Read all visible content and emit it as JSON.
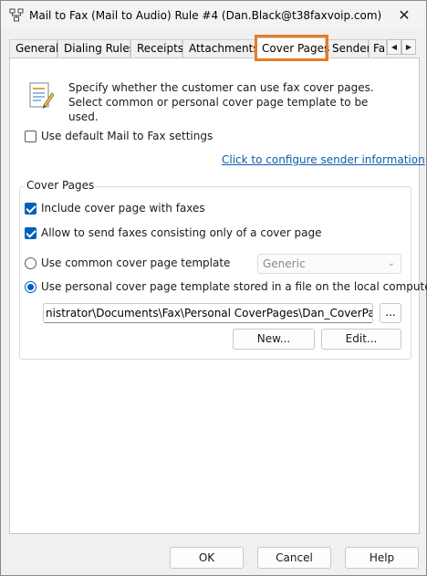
{
  "window": {
    "title": "Mail to Fax (Mail to Audio) Rule #4 (Dan.Black@t38faxvoip.com)",
    "close_glyph": "✕"
  },
  "tabs": [
    {
      "label": "General"
    },
    {
      "label": "Dialing Rules"
    },
    {
      "label": "Receipts"
    },
    {
      "label": "Attachments"
    },
    {
      "label": "Cover Pages",
      "active": true
    },
    {
      "label": "Sender"
    },
    {
      "label": "Fa"
    }
  ],
  "tab_scroll": {
    "left_glyph": "◀",
    "right_glyph": "▶"
  },
  "intro": {
    "text": "Specify whether the customer can use fax cover pages. Select common or personal cover page template to be used."
  },
  "use_default": {
    "label": "Use default Mail to Fax settings",
    "checked": false
  },
  "configure_link": "Click to configure sender information",
  "cover_pages_group": {
    "title": "Cover Pages",
    "include_cover": {
      "label": "Include cover page with faxes",
      "checked": true
    },
    "allow_cover_only": {
      "label": "Allow to send faxes consisting only of a cover page",
      "checked": true
    },
    "use_common": {
      "label": "Use common cover page template",
      "selected": false
    },
    "common_template": {
      "value": "Generic"
    },
    "use_personal": {
      "label": "Use personal cover page template stored in a file on the local computer",
      "selected": true
    },
    "personal_path": {
      "value": "nistrator\\Documents\\Fax\\Personal CoverPages\\Dan_CoverPage.cov"
    },
    "browse_label": "...",
    "new_label": "New...",
    "edit_label": "Edit..."
  },
  "footer": {
    "ok_label": "OK",
    "cancel_label": "Cancel",
    "help_label": "Help"
  },
  "colors": {
    "accent": "#005fb8",
    "tab_highlight": "#e87b24",
    "link": "#0b5cad"
  }
}
